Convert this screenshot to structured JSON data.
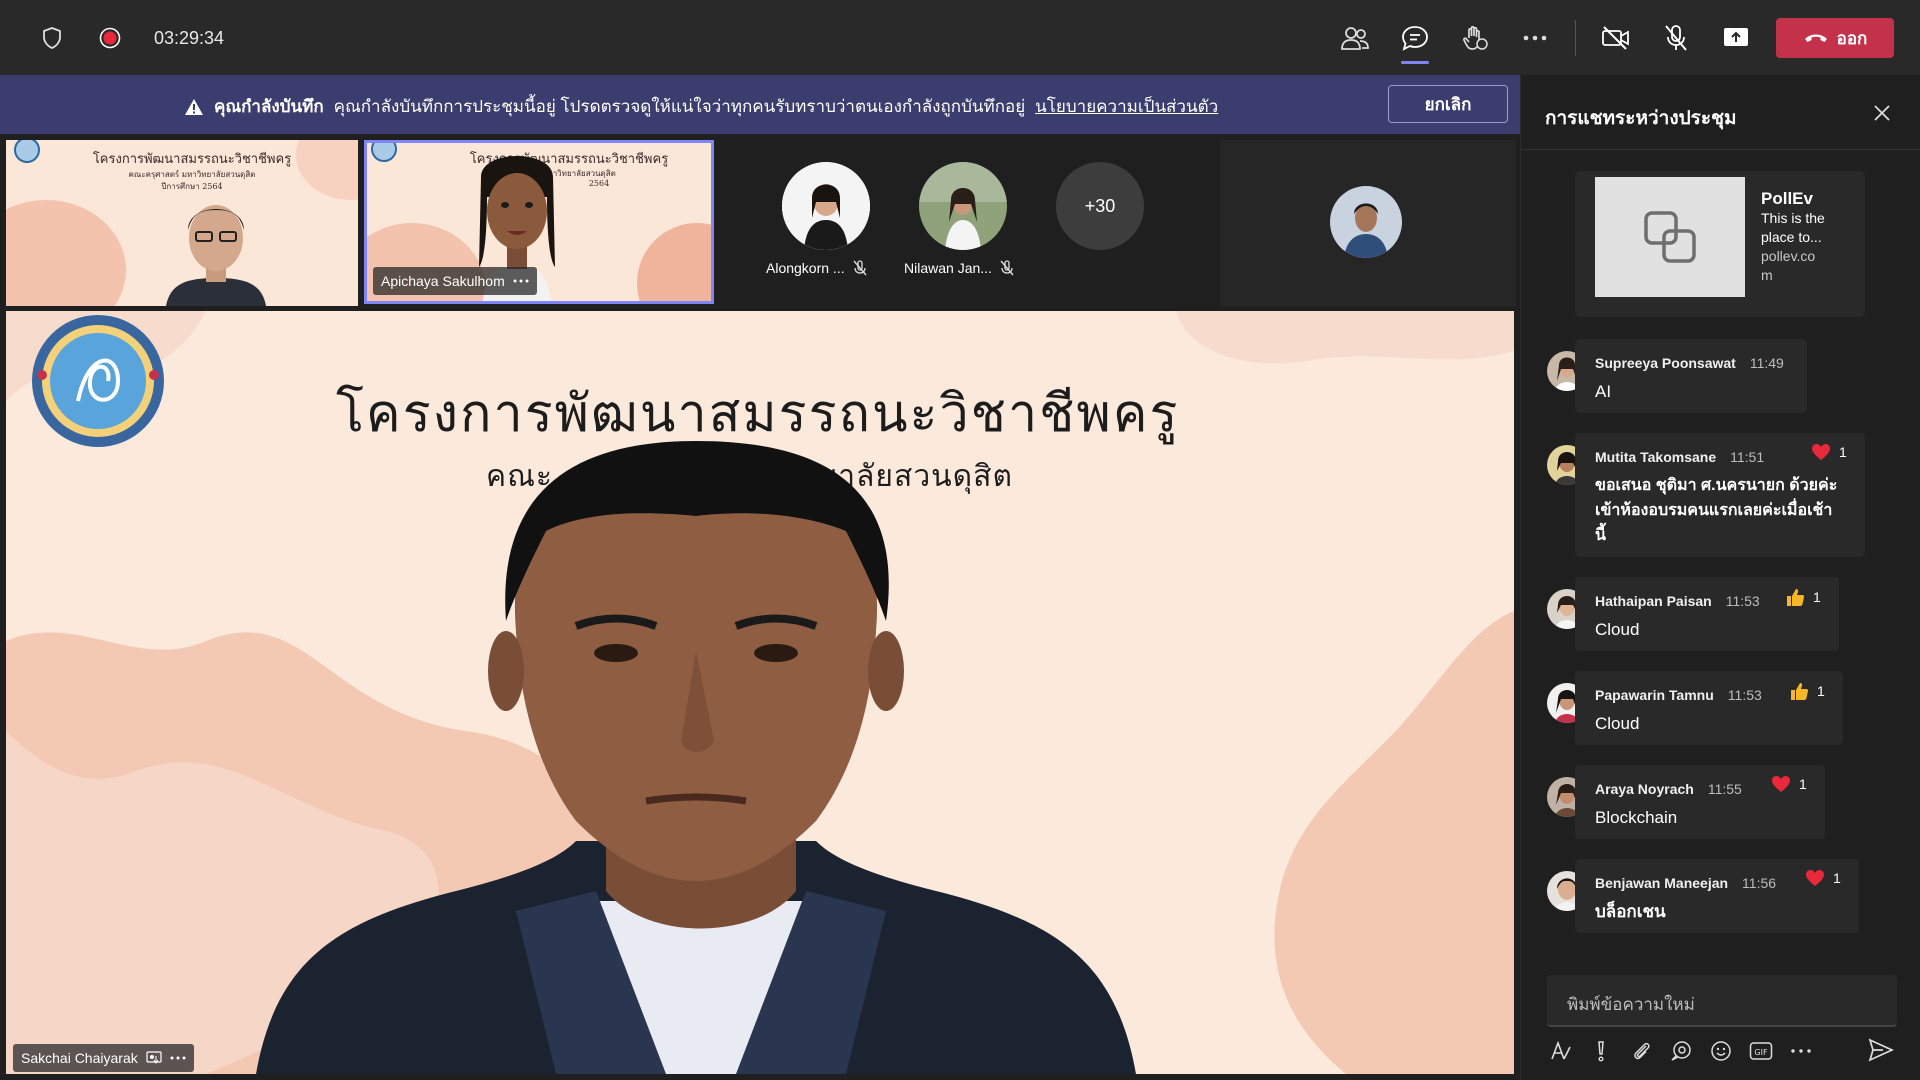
{
  "topbar": {
    "timer": "03:29:34",
    "leave_label": "ออก"
  },
  "banner": {
    "title": "คุณกำลังบันทึก",
    "message": "คุณกำลังบันทึกการประชุมนี้อยู่ โปรดตรวจดูให้แน่ใจว่าทุกคนรับทราบว่าตนเองกำลังถูกบันทึกอยู่",
    "link": "นโยบายความเป็นส่วนตัว",
    "cancel_label": "ยกเลิก"
  },
  "strip": {
    "tile1": {
      "slide_title": "โครงการพัฒนาสมรรถนะวิชาชีพครู",
      "slide_sub1": "คณะครุศาสตร์ มหาวิทยาลัยสวนดุสิต",
      "slide_sub2": "ปีการศึกษา 2564"
    },
    "tile2": {
      "name": "Apichaya Sakulhom",
      "slide_title": "โครงการพัฒนาสมรรถนะวิชาชีพครู",
      "slide_sub1": "มหาวิทยาลัยสวนดุสิต",
      "slide_sub2": "2564"
    },
    "participants": [
      {
        "name": "Alongkorn ..."
      },
      {
        "name": "Nilawan Jan..."
      }
    ],
    "more_count": "+30"
  },
  "main": {
    "slide_title": "โครงการพัฒนาสมรรถนะวิชาชีพครู",
    "slide_sub_left": "คณะ",
    "slide_sub_right": "วิทยาลัยสวนดุสิต",
    "slide_sub2": "564",
    "speaker_name": "Sakchai Chaiyarak"
  },
  "chat": {
    "header": "การแชทระหว่างประชุม",
    "poll": {
      "name": "PollEv",
      "desc1": "This is the",
      "desc2": "place to...",
      "url1": "pollev.co",
      "url2": "m"
    },
    "messages": [
      {
        "author": "Supreeya Poonsawat",
        "time": "11:49",
        "text": "AI",
        "reaction": "",
        "count": ""
      },
      {
        "author": "Mutita Takomsane",
        "time": "11:51",
        "line1": "ขอเสนอ ชุติมา ศ.นครนายก ด้วยค่ะ",
        "line2": "เข้าห้องอบรมคนแรกเลยค่ะเมื่อเช้า",
        "line3": "นี้",
        "reaction": "heart",
        "count": "1"
      },
      {
        "author": "Hathaipan Paisan",
        "time": "11:53",
        "text": "Cloud",
        "reaction": "like",
        "count": "1"
      },
      {
        "author": "Papawarin Tamnu",
        "time": "11:53",
        "text": "Cloud",
        "reaction": "like",
        "count": "1"
      },
      {
        "author": "Araya Noyrach",
        "time": "11:55",
        "text": "Blockchain",
        "reaction": "heart",
        "count": "1"
      },
      {
        "author": "Benjawan Maneejan",
        "time": "11:56",
        "text": "บล็อกเชน",
        "reaction": "heart",
        "count": "1"
      }
    ],
    "compose_placeholder": "พิมพ์ข้อความใหม่"
  },
  "colors": {
    "accent": "#7f85f5",
    "leave": "#c4314b",
    "banner": "#3b3d6e",
    "heart": "#e8293b",
    "like": "#f5b727"
  }
}
